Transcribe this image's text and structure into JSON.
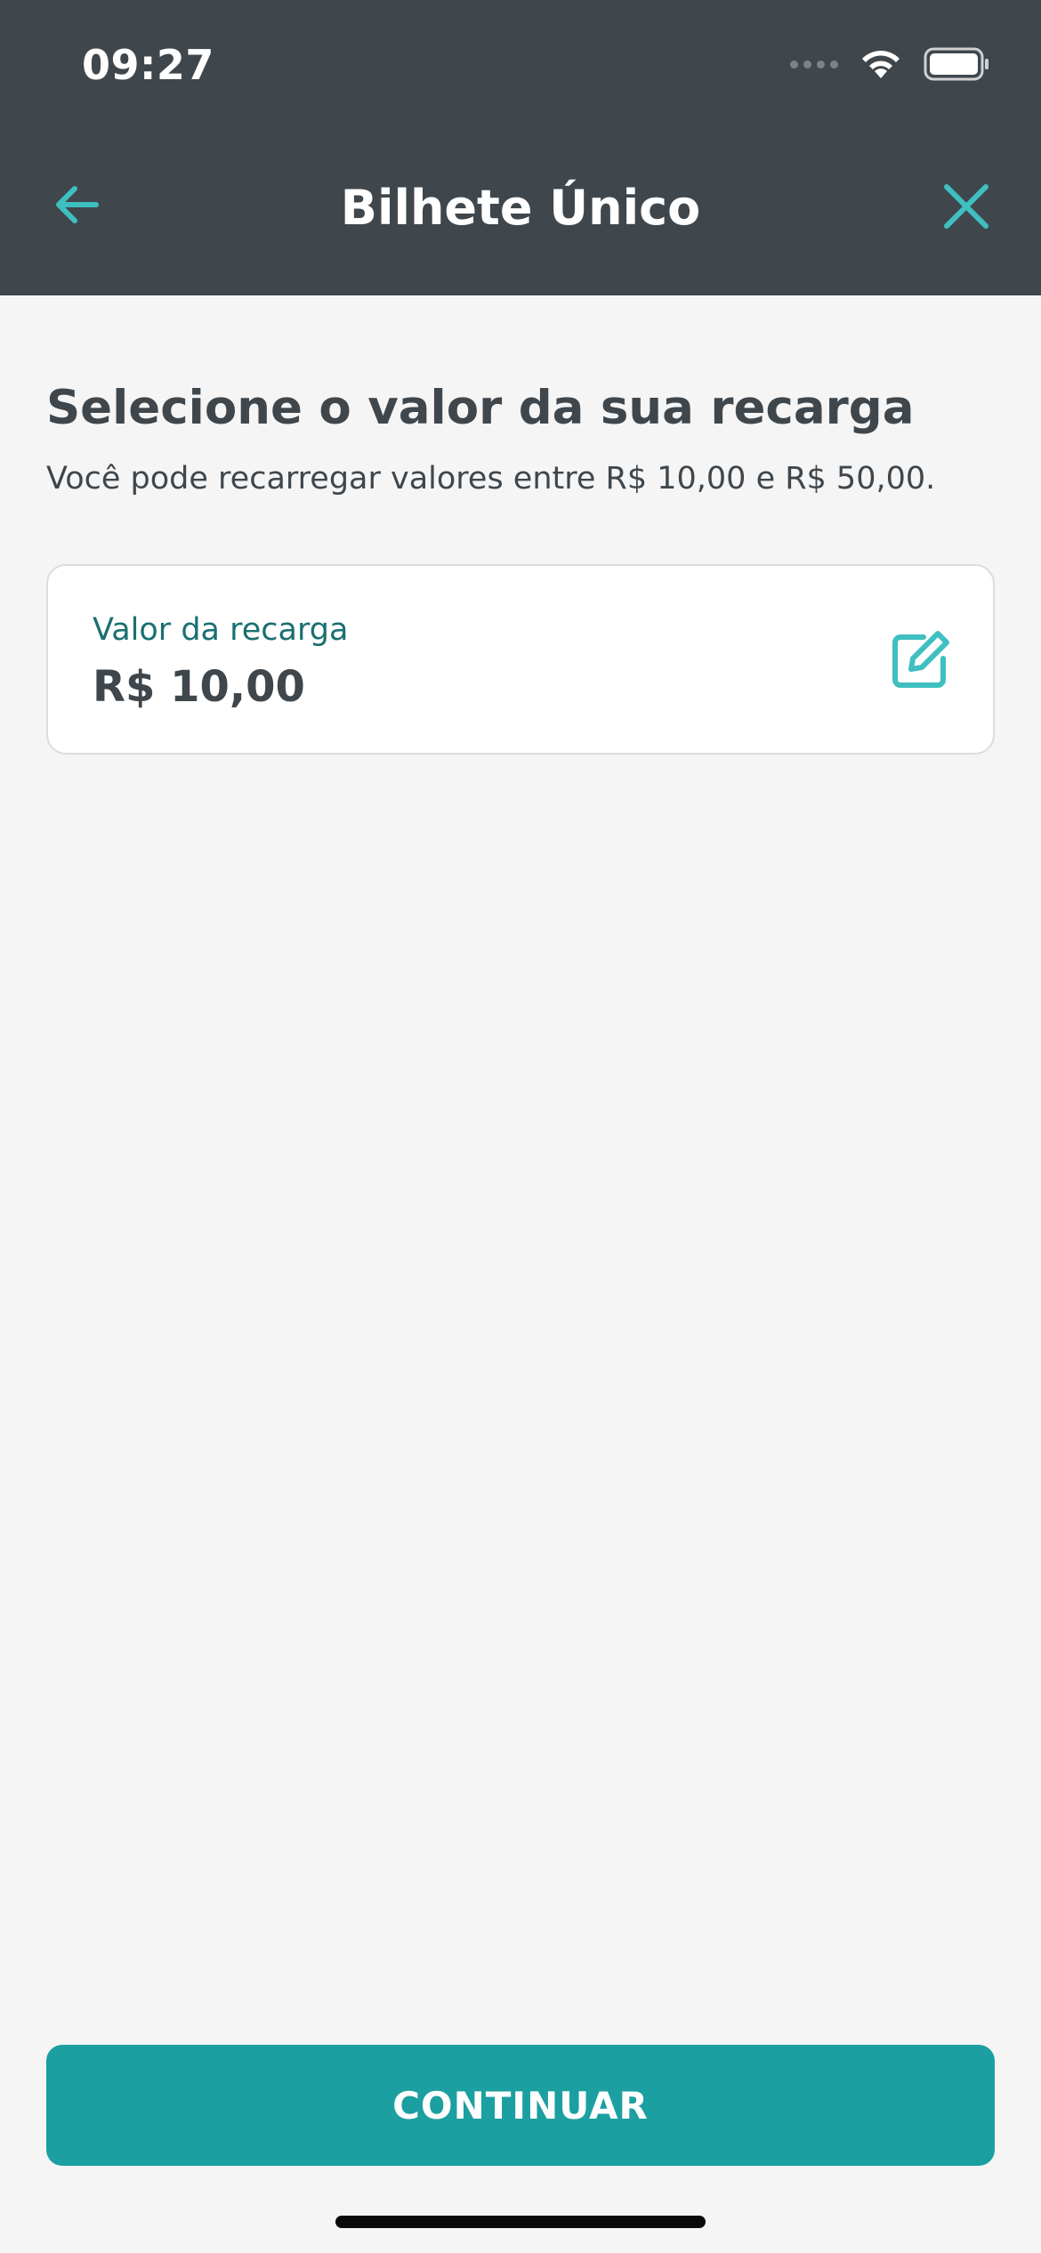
{
  "status_bar": {
    "time": "09:27"
  },
  "nav": {
    "title": "Bilhete Único",
    "back_icon": "arrow-left-icon",
    "close_icon": "close-icon"
  },
  "content": {
    "title": "Selecione o valor da sua recarga",
    "subtitle": "Você pode recarregar valores entre R$ 10,00 e R$ 50,00."
  },
  "value_card": {
    "label": "Valor da recarga",
    "value": "R$ 10,00",
    "edit_icon": "edit-icon"
  },
  "continue_button": {
    "label": "CONTINUAR"
  },
  "colors": {
    "header_bg": "#3f474d",
    "accent": "#1c9fa1",
    "icon_accent": "#3fbfc0",
    "text_dark": "#3f474d",
    "label_teal": "#1b6f70",
    "background": "#f5f5f5"
  }
}
